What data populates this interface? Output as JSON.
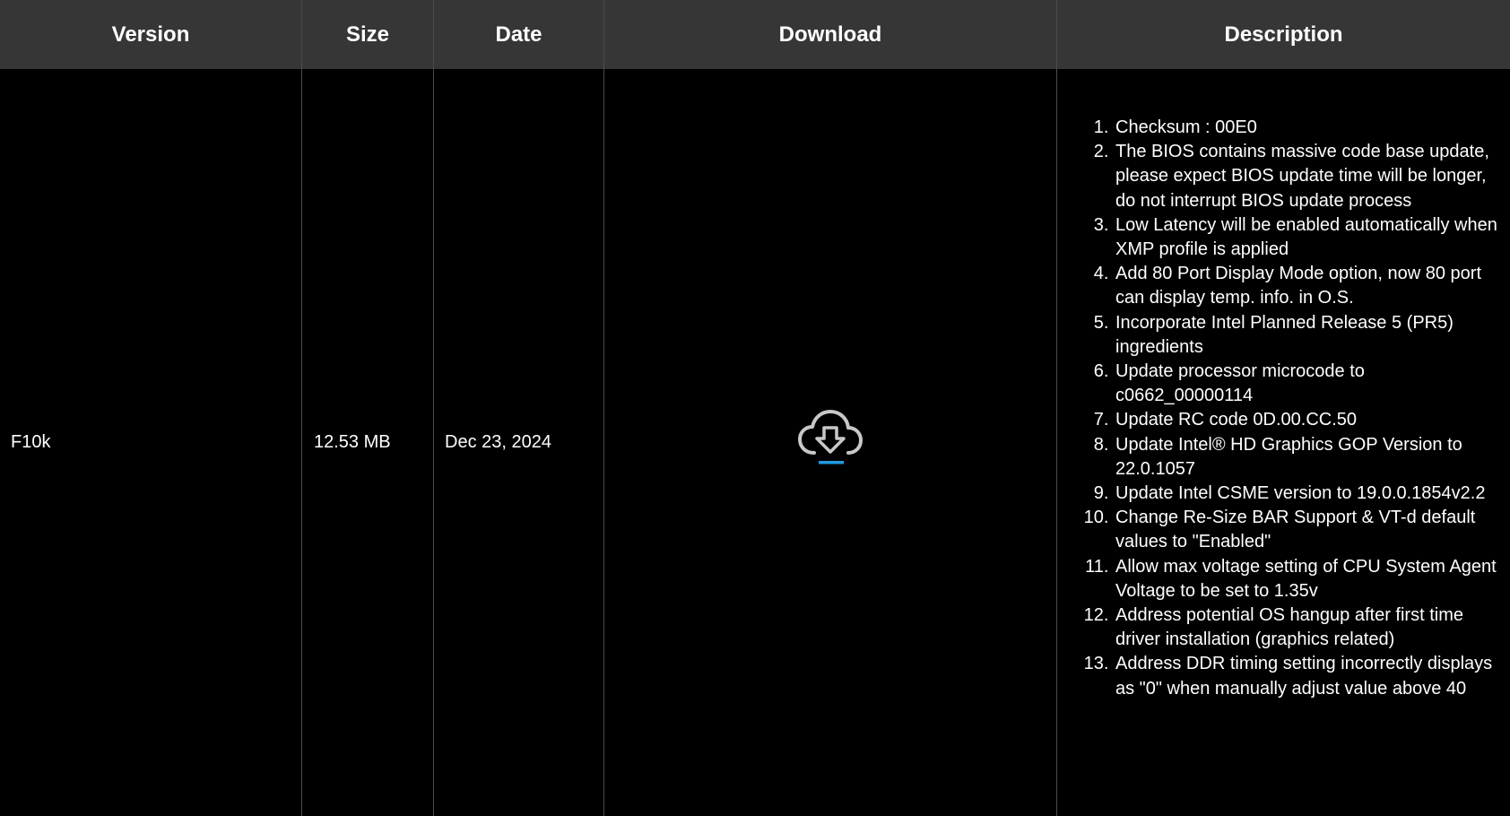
{
  "headers": {
    "version": "Version",
    "size": "Size",
    "date": "Date",
    "download": "Download",
    "description": "Description"
  },
  "row": {
    "version": "F10k",
    "size": "12.53 MB",
    "date": "Dec 23, 2024",
    "download_icon": "cloud-download-icon",
    "description": [
      "Checksum : 00E0",
      "The BIOS contains massive code base update, please expect BIOS update time will be longer, do not interrupt BIOS update process",
      "Low Latency will be enabled automatically when XMP profile is applied",
      "Add 80 Port Display Mode option, now 80 port can display temp. info. in O.S.",
      "Incorporate Intel Planned Release 5 (PR5) ingredients",
      "Update processor microcode to c0662_00000114",
      "Update RC code 0D.00.CC.50",
      "Update Intel® HD Graphics GOP Version to 22.0.1057",
      "Update Intel CSME version to 19.0.0.1854v2.2",
      "Change Re-Size BAR Support & VT-d default values to \"Enabled\"",
      "Allow max voltage setting of CPU System Agent Voltage to be set to 1.35v",
      "Address potential OS hangup after first time driver installation (graphics related)",
      "Address DDR timing setting incorrectly displays as \"0\" when manually adjust value above 40"
    ]
  },
  "colors": {
    "header_bg": "#363636",
    "body_bg": "#000000",
    "icon_gray": "#c8c8c8",
    "accent_blue": "#1e9be0"
  }
}
